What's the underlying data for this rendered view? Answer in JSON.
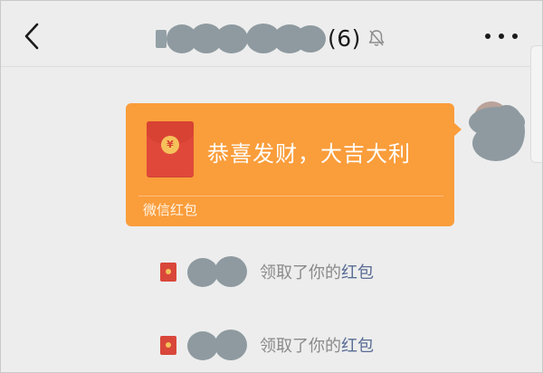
{
  "header": {
    "member_count": "(6)",
    "back_icon": "chevron-left-icon",
    "mute_icon": "bell-muted-icon",
    "more_icon": "more-dots-icon"
  },
  "red_packet": {
    "greeting": "恭喜发财，大吉大利",
    "label": "微信红包",
    "icon": "red-envelope-icon",
    "color": "#fa9d3b"
  },
  "notices": [
    {
      "text": "领取了你的",
      "link": "红包",
      "icon": "red-envelope-icon"
    },
    {
      "text": "领取了你的",
      "link": "红包",
      "icon": "red-envelope-icon"
    }
  ],
  "colors": {
    "background": "#ededed",
    "packet": "#fa9d3b",
    "link": "#586c94",
    "notice_text": "#8a8a8a"
  }
}
